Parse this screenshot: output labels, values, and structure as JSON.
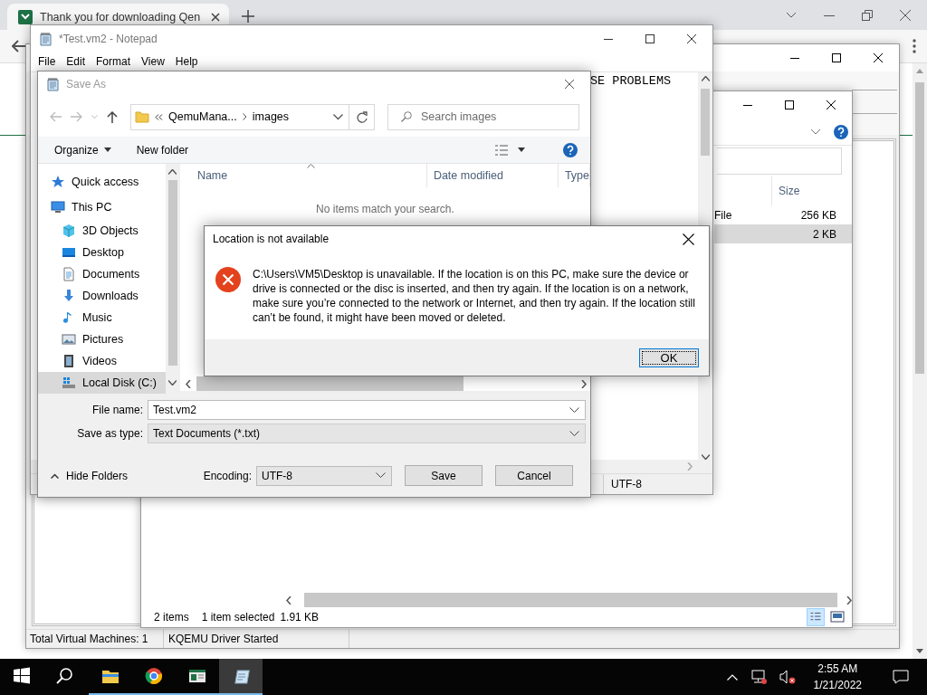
{
  "browser": {
    "tab_title": "Thank you for downloading Qen"
  },
  "manager_window": {
    "status_bar": [
      "Total Virtual Machines: 1",
      "KQEMU Driver Started"
    ]
  },
  "explorer_window": {
    "columns": [
      "Size"
    ],
    "rows": [
      {
        "type": "File",
        "size": "256 KB",
        "selected": false
      },
      {
        "size": "2 KB",
        "selected": true
      }
    ],
    "status_bar": [
      "2 items",
      "1 item selected",
      "1.91 KB"
    ]
  },
  "notepad": {
    "title": "*Test.vm2 - Notepad",
    "menu": [
      "File",
      "Edit",
      "Format",
      "View",
      "Help"
    ],
    "text": "SE PROBLEMS",
    "encoding": "UTF-8"
  },
  "save_as": {
    "title": "Save As",
    "breadcrumb": [
      "QemuMana...",
      "images"
    ],
    "search": {
      "placeholder": "Search images"
    },
    "toolbar": [
      {
        "label": "Organize",
        "kind": "menu"
      },
      {
        "label": "New folder",
        "kind": "button"
      }
    ],
    "nav_pane": [
      {
        "label": "Quick access",
        "kind": "star",
        "selected": false
      },
      {
        "label": "This PC",
        "kind": "pc",
        "selected": false,
        "children": [
          {
            "label": "3D Objects",
            "kind": "cube",
            "selected": false
          },
          {
            "label": "Desktop",
            "kind": "desktop",
            "selected": false
          },
          {
            "label": "Documents",
            "kind": "documents",
            "selected": false
          },
          {
            "label": "Downloads",
            "kind": "downloads",
            "selected": false
          },
          {
            "label": "Music",
            "kind": "music",
            "selected": false
          },
          {
            "label": "Pictures",
            "kind": "pictures",
            "selected": false
          },
          {
            "label": "Videos",
            "kind": "videos",
            "selected": false
          },
          {
            "label": "Local Disk (C:)",
            "kind": "disk",
            "selected": true
          }
        ]
      }
    ],
    "columns": [
      {
        "label": "Name",
        "sorted": true
      },
      {
        "label": "Date modified",
        "sorted": false
      },
      {
        "label": "Type",
        "sorted": false
      }
    ],
    "empty_message": "No items match your search.",
    "file_name": {
      "label": "File name:",
      "value": "Test.vm2"
    },
    "save_as_type": {
      "label": "Save as type:",
      "value": "Text Documents (*.txt)"
    },
    "hide_folders": "Hide Folders",
    "encoding": {
      "label": "Encoding:",
      "value": "UTF-8"
    },
    "buttons": [
      "Save",
      "Cancel"
    ]
  },
  "error_dialog": {
    "title": "Location is not available",
    "message": "C:\\Users\\VM5\\Desktop is unavailable. If the location is on this PC, make sure the device or drive is connected or the disc is inserted, and then try again. If the location is on a network, make sure you’re connected to the network or Internet, and then try again. If the location still can’t be found, it might have been moved or deleted.",
    "button": "OK"
  },
  "taskbar": {
    "apps": [
      {
        "kind": "start",
        "running": false,
        "active": false
      },
      {
        "kind": "search",
        "running": false,
        "active": false
      },
      {
        "kind": "explorer",
        "running": true,
        "active": false
      },
      {
        "kind": "browser",
        "running": true,
        "active": false
      },
      {
        "kind": "app",
        "running": true,
        "active": false
      },
      {
        "kind": "notepad",
        "running": true,
        "active": true
      }
    ],
    "time": "2:55 AM",
    "date": "1/21/2022"
  }
}
